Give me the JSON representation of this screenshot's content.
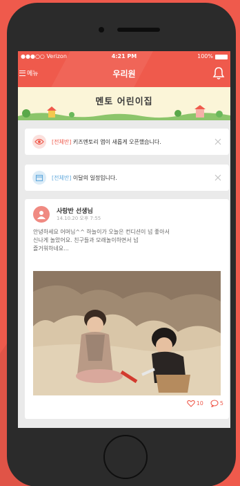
{
  "status_bar": {
    "carrier": "●●●○○ Verizon",
    "time": "4:21 PM",
    "battery": "100%"
  },
  "header": {
    "menu_label": "메뉴",
    "title": "우리원"
  },
  "banner": {
    "title": "멘토 어린이집"
  },
  "notices": [
    {
      "tag": "[전체반]",
      "text": "키즈멘토리 앱이 새롭게 오픈했습니다.",
      "icon": "eye-icon"
    },
    {
      "tag": "[전체반]",
      "text": "이달의 일정입니다.",
      "icon": "calendar-icon"
    }
  ],
  "post": {
    "author": "사랑반 선생님",
    "time": "14.10.20 오후 7:55",
    "body_lines": [
      "안녕하세요 어머님^^ 하늘이가 오늘은 컨디션이 넘 좋아서",
      "신나게 놀았어요. 친구들과 모래놀이하면서 넘",
      "즐거워하네요..."
    ],
    "likes": "10",
    "comments": "5"
  },
  "colors": {
    "accent": "#ef5a4c",
    "link_blue": "#5fa8dc",
    "banner_bg": "#fbf5d8"
  }
}
